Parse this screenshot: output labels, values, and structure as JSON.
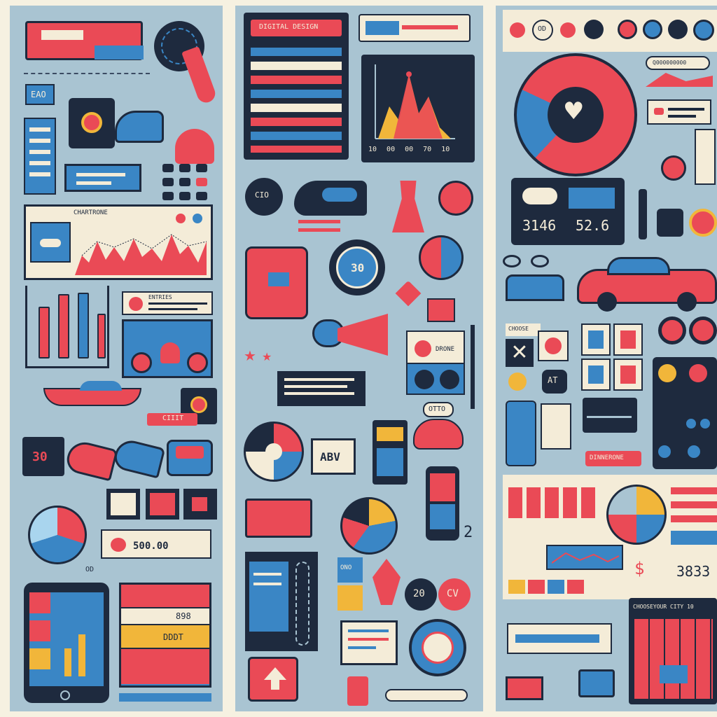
{
  "colors": {
    "background": "#f6f1e1",
    "panel": "#a9c4d2",
    "navy": "#1e2a3e",
    "red": "#ea4a56",
    "blue": "#3a86c5",
    "cream": "#f4ecd8",
    "yellow": "#f1b63a"
  },
  "left_panel": {
    "tag": "ЕАО",
    "chart_header": "CHARTRONE",
    "card_title": "ENTRIES",
    "tag_30": "30",
    "tag_button": "CIIIT",
    "price": "500.00",
    "small_label": "OD",
    "list_value_1": "898",
    "list_value_2": "DDDT"
  },
  "middle_panel": {
    "header": "DIGITAL DESIGN",
    "chart_x_ticks": [
      "10",
      "00",
      "00",
      "70",
      "10"
    ],
    "timer_label": "30",
    "card_caption": "DRONE",
    "abv_label": "ABV",
    "sign_label": "OTTO",
    "badge_20": "20",
    "badge_cv": "CV",
    "num_2": "2",
    "box_label": "ONO",
    "circle_label": "CIO"
  },
  "right_panel": {
    "tag_top": "OD",
    "pill_label": "Q000000000",
    "weather_value_1": "3146",
    "weather_value_2": "52.6",
    "tag_at": "AT",
    "button_label": "DINNERONE",
    "list_header": "CHOOSE",
    "currency_symbol": "$",
    "currency_value": "3833",
    "footer_header": "CHOOSEYOUR CITY 10"
  },
  "icons": [
    "stopwatch-icon",
    "shopping-bag-icon",
    "sneaker-icon",
    "dress-icon",
    "tshirt-icon",
    "alarm-clock-icon",
    "heart-icon",
    "gift-icon",
    "megaphone-icon",
    "car-icon",
    "truck-icon",
    "lightbulb-icon",
    "cloud-icon",
    "smartphone-icon",
    "pie-chart-icon",
    "bar-chart-icon",
    "line-chart-icon",
    "arrow-up-icon",
    "star-icon",
    "eyeglasses-icon"
  ]
}
